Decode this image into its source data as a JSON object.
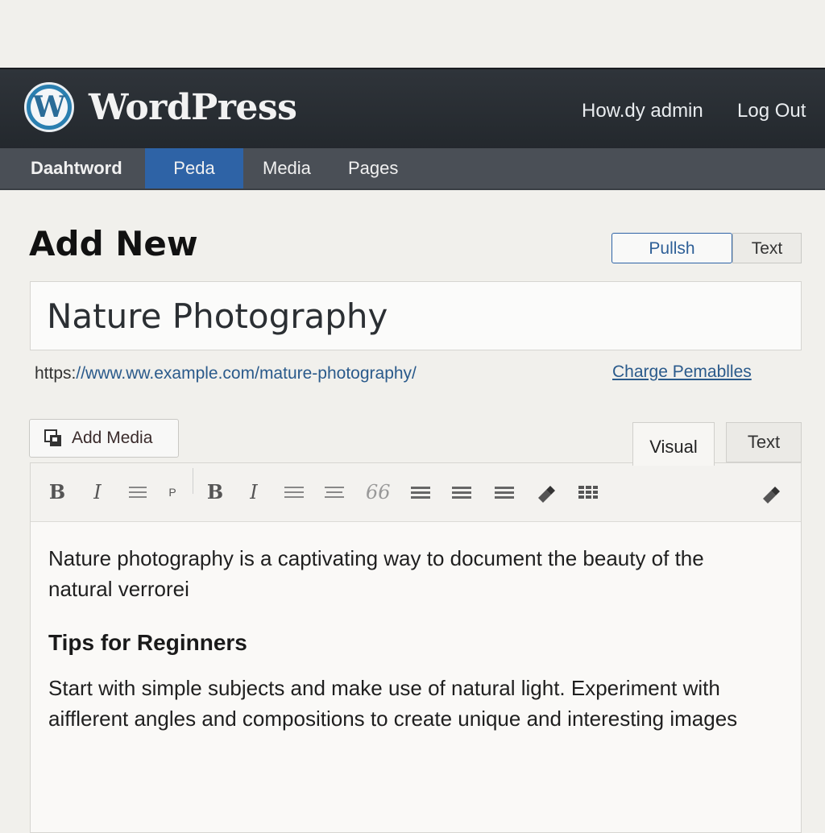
{
  "admin_bar": {
    "logo_letter": "W",
    "brand": "WordPress",
    "greeting": "How.dy admin",
    "logout": "Log Out"
  },
  "nav": {
    "items": [
      {
        "label": "Daahtword"
      },
      {
        "label": "Peda"
      },
      {
        "label": "Media"
      },
      {
        "label": "Pages"
      }
    ],
    "active_index": 1
  },
  "page": {
    "title": "Add New",
    "publish_label": "Pullsh",
    "text_label": "Text"
  },
  "post": {
    "title": "Nature Photography",
    "permalink_prefix": "https:",
    "permalink_url": "//www.ww.example.com/mature-photography/",
    "change_permalinks": "Charge Pemablles"
  },
  "editor": {
    "add_media": "Add Media",
    "tab_visual": "Visual",
    "tab_text": "Text",
    "active_tab": "Visual",
    "paragraph1": "Nature photography is a captivating way to document the beauty of the natural verrorei",
    "heading": "Tips for Reginners",
    "paragraph2": "Start with simple subjects and make use of natural light. Experiment with aifflerent angles and compositions to create unique and interesting images",
    "toolbar": {
      "bold": "B",
      "italic": "I",
      "paragraph": "P",
      "bold2": "B",
      "italic2": "I",
      "quote": "66"
    }
  },
  "colors": {
    "admin_bar": "#23282d",
    "nav_bar": "#4a4f56",
    "nav_active": "#2e63a6",
    "link": "#2a5a8b"
  }
}
